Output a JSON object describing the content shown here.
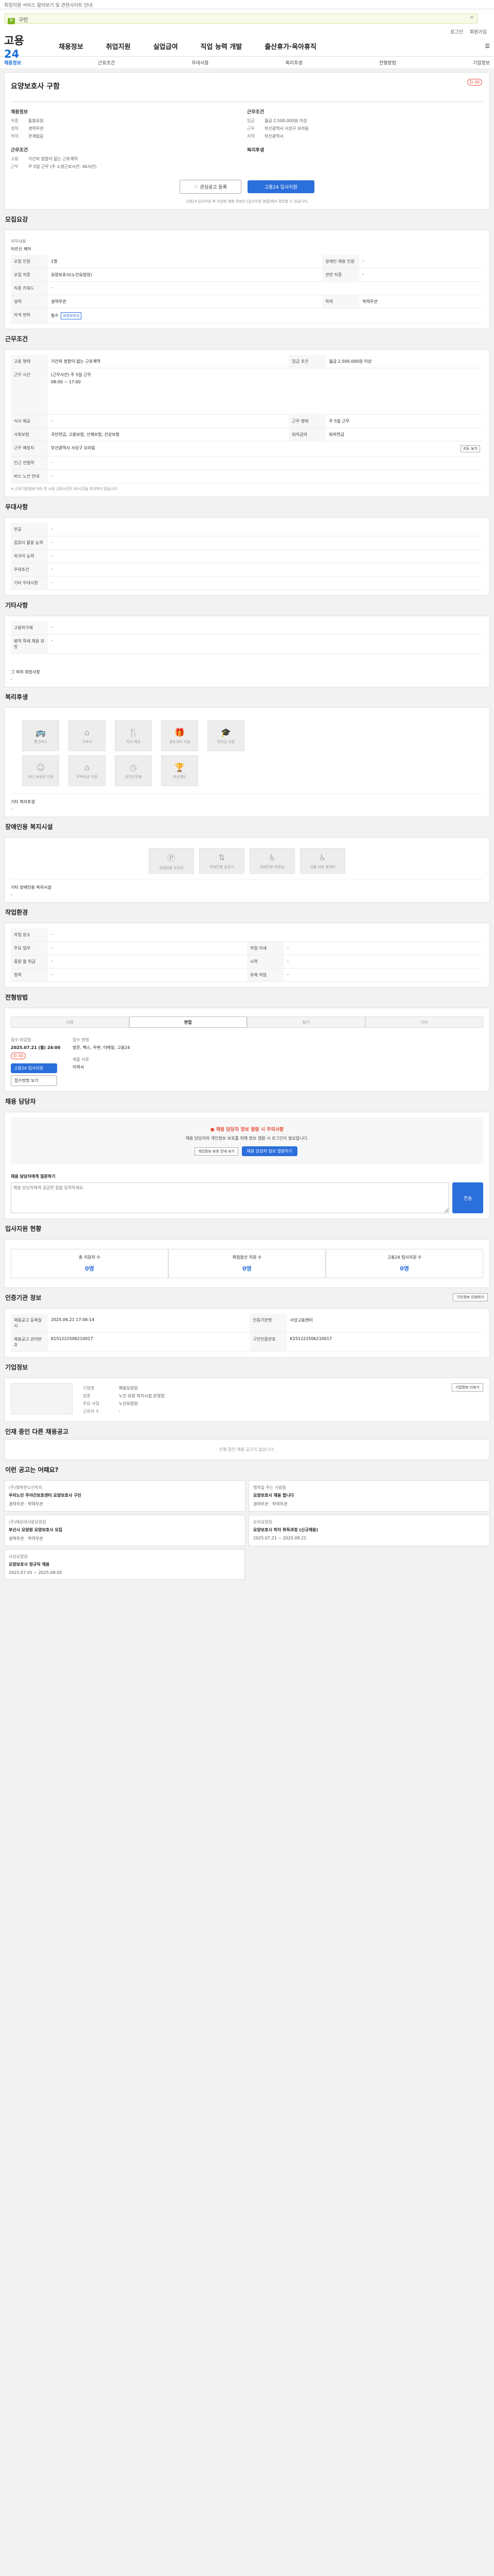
{
  "topbar": {
    "notice": "취업지원 서비스 알아보기 및 관련사이트 안내"
  },
  "search": {
    "tag": "N",
    "value": "구인",
    "close": "✕"
  },
  "user": {
    "login": "로그인",
    "join": "회원가입"
  },
  "gnb": {
    "logo_a": "고용",
    "logo_b": "24",
    "menu": [
      "채용정보",
      "취업지원",
      "실업급여",
      "직업 능력 개발",
      "출산휴가·육아휴직"
    ]
  },
  "subnav": [
    "채용정보",
    "근로조건",
    "우대사항",
    "복리후생",
    "전형방법",
    "기업정보"
  ],
  "job": {
    "dday": "D-30",
    "title": "요양보호사 구함",
    "section_recruit": "채용정보",
    "job_label": "직종",
    "job_value": "돌봄요원",
    "type_label": "고용",
    "type_value": "기간의 정함이 없는 근로계약",
    "place_label": "지역",
    "place_value": "부산광역시",
    "hours_label": "근무",
    "hours_value": "주 5일 근무 (주 소정근로시간: 40시간)",
    "cond_title": "근무조건",
    "edu_label": "학력",
    "edu_value": "관계없음",
    "pay_label": "임금",
    "pay_value": "월급 2,500,000원 이상",
    "loc_label": "근무",
    "loc_value": "부산광역시 사상구 모라동",
    "career_label": "경력",
    "career_value": "경력무관",
    "benefit_title": "복리후생"
  },
  "actions": {
    "save": "관심공고 등록",
    "apply": "고용24 입사지원",
    "note": "고용24 입사지원 후 지원한 채용 정보는 [입사지원 현황]에서 확인할 수 있습니다."
  },
  "recruit_table": {
    "title": "모집요강",
    "duty_label": "직무내용",
    "duty_value": "어르신 케어",
    "rows": [
      {
        "k": "모집 인원",
        "v": "1명",
        "k2": "장애인 채용 인원",
        "v2": "-"
      },
      {
        "k": "모집 직종",
        "v": "요양보호사(노인요양원)",
        "k2": "관련 직종",
        "v2": "-"
      },
      {
        "k": "직종 키워드",
        "v": "-",
        "k2": "",
        "v2": ""
      },
      {
        "k": "경력",
        "v": "경력무관",
        "k2": "학력",
        "v2": "학력무관"
      },
      {
        "k": "자격 면허",
        "v": "필수",
        "k2": "",
        "v2": "요양보호사"
      }
    ]
  },
  "work_table": {
    "title": "근무조건",
    "rows": [
      {
        "k": "고용 형태",
        "v": "기간의 정함이 없는 근로계약",
        "k2": "임금 조건",
        "v2": "월급 2,500,000원 이상"
      },
      {
        "k": "근무 시간",
        "v": "(근무시간) 주 5일 근무",
        "k2": "",
        "v2": ""
      },
      {
        "k": "식사 제공",
        "v": "-",
        "k2": "근무 형태",
        "v2": "주 5일 근무"
      },
      {
        "k": "사회보험",
        "v": "국민연금, 고용보험, 산재보험, 건강보험",
        "k2": "퇴직급여",
        "v2": "퇴직연금"
      },
      {
        "k": "근무 예정지",
        "v": "부산광역시 사상구 모라동",
        "k2": "",
        "v2": ""
      },
      {
        "k": "인근 전철역",
        "v": "-",
        "k2": "",
        "v2": ""
      },
      {
        "k": "버스 노선 안내",
        "v": "-",
        "k2": "",
        "v2": ""
      }
    ],
    "detail": "08:00 ~ 17:00",
    "map_btn": "지도 보기",
    "foot": "※ 근로기준법에 따라 주 소정 근로시간이 40시간을 초과하지 않습니다."
  },
  "pref": {
    "title": "우대사항",
    "rows": [
      {
        "k": "전공",
        "v": "-"
      },
      {
        "k": "컴퓨터 활용 능력",
        "v": "-"
      },
      {
        "k": "외국어 능력",
        "v": "-"
      },
      {
        "k": "우대조건",
        "v": "-"
      },
      {
        "k": "기타 우대사항",
        "v": "-"
      }
    ]
  },
  "etc": {
    "title": "기타사항",
    "rows": [
      {
        "k": "고용허가제",
        "v": "-"
      },
      {
        "k": "병역 특례 채용 희망",
        "v": "-"
      }
    ],
    "other_label": "그 외의 희망사항",
    "other_value": "-"
  },
  "welfare": {
    "title": "복리후생",
    "items": [
      "통근버스",
      "기숙사",
      "식사 제공",
      "경조사비 지원",
      "학자금 지원",
      "자녀 보육비 지원",
      "주택자금 지원",
      "유연근무제",
      "포상제도"
    ],
    "other_label": "기타 복리후생",
    "other_value": "-"
  },
  "disabled": {
    "title": "장애인용 복지시설",
    "items": [
      "장애인용 주차장",
      "장애인용 승강기",
      "장애인용 화장실",
      "건물 내부 휠체어"
    ],
    "other_label": "기타 장애인용 복지시설",
    "other_value": "-"
  },
  "workenv": {
    "title": "작업환경",
    "rows": [
      {
        "k": "작업 장소",
        "v": "-",
        "k2": "",
        "v2": ""
      },
      {
        "k": "주요 업무",
        "v": "-",
        "k2": "작업 자세",
        "v2": "-"
      },
      {
        "k": "중량 물 취급",
        "v": "-",
        "k2": "시력",
        "v2": "-"
      },
      {
        "k": "청력",
        "v": "-",
        "k2": "유해 작업",
        "v2": "-"
      }
    ]
  },
  "process": {
    "title": "전형방법",
    "steps": [
      "서류",
      "면접",
      "필기",
      "기타"
    ],
    "deadline_label": "접수 마감일",
    "deadline_value": "2025.07.21 (월) 24:00",
    "dday": "D-30",
    "method_label": "접수 방법",
    "method_value": "방문, 팩스, 우편, 이메일, 고용24",
    "docs_label": "제출 서류",
    "docs_value": "이력서",
    "apply_btn": "고용24 입사지원",
    "email_btn": "접수방법 보기"
  },
  "contact": {
    "title": "채용 담당자",
    "warn": "채용 담당자 정보 열람 시 주의사항",
    "note": "채용 담당자의 개인정보 보호를 위해 정보 열람 시 로그인이 필요합니다.",
    "btn": "채용 담당자 정보 열람하기",
    "btn2": "개인정보 보호 안내 보기",
    "inquiry_title": "채용 담당자에게 질문하기",
    "inquiry_ph": "채용 담당자에게 궁금한 점을 입력하세요.",
    "inquiry_btn": "전송"
  },
  "status": {
    "title": "입사지원 현황",
    "items": [
      {
        "k": "총 지원자 수",
        "v": "0명"
      },
      {
        "k": "취업알선 지원 수",
        "v": "0명"
      },
      {
        "k": "고용24 입사지원 수",
        "v": "0명"
      }
    ]
  },
  "info": {
    "title": "인증기관 정보",
    "print": "구인정보 인쇄하기",
    "rows": [
      {
        "k": "채용공고 등록일시",
        "v": "2025.06.21 17:06:14",
        "k2": "인증기관명",
        "v2": "사상고용센터"
      },
      {
        "k": "채용공고 관리번호",
        "v": "K151222506210017",
        "k2": "구인인증번호",
        "v2": "K151222506210017"
      }
    ]
  },
  "company": {
    "title": "기업정보",
    "rows": [
      {
        "k": "기업명",
        "v": "해봉요양원"
      },
      {
        "k": "업종",
        "v": "노인 요양 복지시설 운영업"
      },
      {
        "k": "주요 사업",
        "v": "노인요양원"
      },
      {
        "k": "근로자 수",
        "v": "-"
      }
    ],
    "btn": "기업정보 더보기"
  },
  "related": {
    "title": "인재 중인 다른 채용공고",
    "empty": "진행 중인 채용 공고가 없습니다."
  },
  "recommend": {
    "title": "이런 공고는 어때요?",
    "cards": [
      {
        "co": "(주)행복한노인복지",
        "t": "우리노인 주야간보호센터 요양보호사 구인",
        "s": "경력무관 · 학력무관"
      },
      {
        "co": "행복을 주는 사람들",
        "t": "요양보호사 채용 합니다",
        "s": "경력무관 · 학력무관"
      },
      {
        "co": "(주)해운대사랑요양원",
        "t": "부산시 요양원 요양보호사 모집",
        "s": "경력무관 · 학력무관"
      },
      {
        "co": "모라요양원",
        "t": "요양보호사 하자 취득과정 (신규채용)",
        "s": "2025.07.21 ~ 2025.08.21"
      },
      {
        "co": "사상요양원",
        "t": "요양보호사 정규직 채용",
        "s": "2025.07.05 ~ 2025.08.05"
      }
    ]
  }
}
